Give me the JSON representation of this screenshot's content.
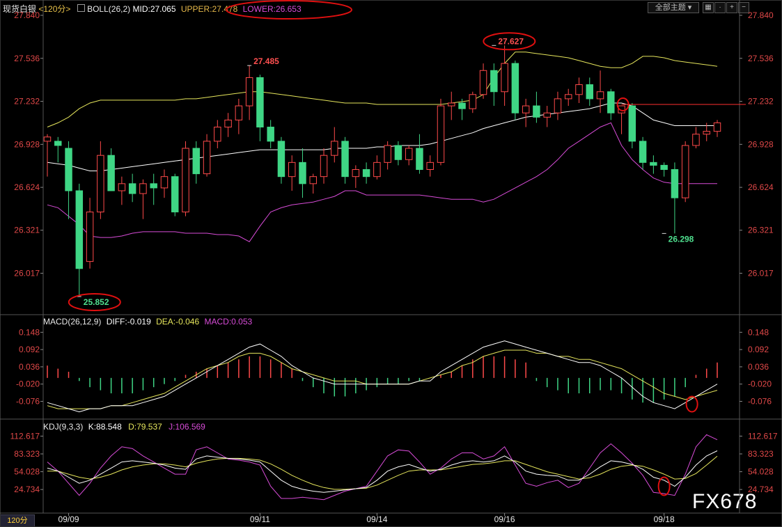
{
  "header": {
    "title": "现货白银",
    "period": "<120分>",
    "boll": "BOLL(26,2)",
    "mid": "MID:27.065",
    "upper": "UPPER:27.478",
    "lower": "LOWER:26.653",
    "theme_button": "全部主题",
    "icons": [
      "grid-icon",
      "dot-icon",
      "add-icon",
      "remove-icon"
    ]
  },
  "macd_header": {
    "label": "MACD(26,12,9)",
    "diff": "DIFF:-0.019",
    "dea": "DEA:-0.046",
    "macd": "MACD:0.053"
  },
  "kdj_header": {
    "label": "KDJ(9,3,3)",
    "k": "K:88.548",
    "d": "D:79.537",
    "j": "J:106.569"
  },
  "period_badge": "120分",
  "watermark": "FX678",
  "colors": {
    "up": "#ff4a4a",
    "down": "#3fd685",
    "mid": "#ffffff",
    "upper": "#e6e65c",
    "lower": "#d84cd8",
    "axis_label": "#e04848",
    "circle": "#e01010"
  },
  "chart_data": [
    {
      "type": "candlestick",
      "name": "price",
      "y_ticks": [
        27.84,
        27.536,
        27.232,
        26.928,
        26.624,
        26.321,
        26.017
      ],
      "ylim": [
        25.852,
        27.84
      ],
      "x_labels": [
        "09/09",
        "09/11",
        "09/14",
        "09/16",
        "09/18"
      ],
      "x_label_positions": [
        2,
        20,
        31,
        43,
        58
      ],
      "annotations": [
        {
          "text": "27.485",
          "index": 19,
          "value": 27.485,
          "kind": "high"
        },
        {
          "text": "27.627",
          "index": 42,
          "value": 27.627,
          "kind": "high",
          "circled": true
        },
        {
          "text": "25.852",
          "index": 3,
          "value": 25.852,
          "kind": "low",
          "circled": true
        },
        {
          "text": "26.298",
          "index": 58,
          "value": 26.298,
          "kind": "low"
        }
      ],
      "resistance_line": {
        "value": 27.21,
        "from_index": 54
      },
      "candles": [
        [
          26.95,
          27.0,
          26.7,
          26.98
        ],
        [
          26.95,
          26.98,
          26.8,
          26.92
        ],
        [
          26.9,
          26.95,
          26.4,
          26.6
        ],
        [
          26.6,
          26.65,
          25.852,
          26.05
        ],
        [
          26.1,
          26.55,
          26.05,
          26.45
        ],
        [
          26.45,
          26.95,
          26.4,
          26.85
        ],
        [
          26.85,
          26.9,
          26.6,
          26.6
        ],
        [
          26.6,
          26.7,
          26.5,
          26.65
        ],
        [
          26.65,
          26.72,
          26.52,
          26.58
        ],
        [
          26.58,
          26.68,
          26.4,
          26.65
        ],
        [
          26.65,
          26.72,
          26.5,
          26.62
        ],
        [
          26.62,
          26.75,
          26.55,
          26.7
        ],
        [
          26.7,
          26.72,
          26.42,
          26.45
        ],
        [
          26.45,
          26.95,
          26.42,
          26.9
        ],
        [
          26.9,
          26.95,
          26.65,
          26.72
        ],
        [
          26.72,
          27.0,
          26.7,
          26.95
        ],
        [
          26.95,
          27.1,
          26.9,
          27.05
        ],
        [
          27.05,
          27.15,
          26.98,
          27.1
        ],
        [
          27.1,
          27.25,
          27.0,
          27.2
        ],
        [
          27.2,
          27.485,
          27.1,
          27.4
        ],
        [
          27.4,
          27.42,
          26.95,
          27.05
        ],
        [
          27.05,
          27.1,
          26.9,
          26.95
        ],
        [
          26.95,
          26.98,
          26.65,
          26.7
        ],
        [
          26.7,
          26.85,
          26.6,
          26.8
        ],
        [
          26.8,
          26.9,
          26.55,
          26.65
        ],
        [
          26.65,
          26.72,
          26.58,
          26.7
        ],
        [
          26.7,
          26.9,
          26.65,
          26.85
        ],
        [
          26.85,
          27.05,
          26.8,
          26.95
        ],
        [
          26.95,
          26.98,
          26.65,
          26.7
        ],
        [
          26.7,
          26.78,
          26.62,
          26.75
        ],
        [
          26.75,
          26.8,
          26.65,
          26.7
        ],
        [
          26.7,
          26.85,
          26.68,
          26.8
        ],
        [
          26.8,
          26.95,
          26.75,
          26.92
        ],
        [
          26.92,
          26.95,
          26.78,
          26.82
        ],
        [
          26.82,
          26.92,
          26.78,
          26.9
        ],
        [
          26.9,
          27.0,
          26.72,
          26.75
        ],
        [
          26.75,
          26.85,
          26.7,
          26.8
        ],
        [
          26.8,
          27.25,
          26.78,
          27.2
        ],
        [
          27.2,
          27.3,
          27.1,
          27.22
        ],
        [
          27.22,
          27.25,
          27.1,
          27.18
        ],
        [
          27.18,
          27.3,
          27.15,
          27.28
        ],
        [
          27.28,
          27.5,
          27.25,
          27.45
        ],
        [
          27.45,
          27.5,
          27.2,
          27.3
        ],
        [
          27.3,
          27.627,
          27.2,
          27.5
        ],
        [
          27.5,
          27.52,
          27.1,
          27.15
        ],
        [
          27.15,
          27.25,
          27.05,
          27.2
        ],
        [
          27.2,
          27.3,
          27.08,
          27.12
        ],
        [
          27.12,
          27.2,
          27.05,
          27.15
        ],
        [
          27.15,
          27.3,
          27.1,
          27.25
        ],
        [
          27.25,
          27.32,
          27.2,
          27.28
        ],
        [
          27.28,
          27.4,
          27.22,
          27.35
        ],
        [
          27.35,
          27.4,
          27.2,
          27.25
        ],
        [
          27.25,
          27.45,
          27.15,
          27.3
        ],
        [
          27.3,
          27.32,
          27.1,
          27.15
        ],
        [
          27.15,
          27.2,
          27.0,
          27.2
        ],
        [
          27.2,
          27.22,
          26.9,
          26.95
        ],
        [
          26.95,
          26.98,
          26.75,
          26.8
        ],
        [
          26.8,
          26.85,
          26.72,
          26.78
        ],
        [
          26.78,
          26.8,
          26.7,
          26.75
        ],
        [
          26.75,
          26.8,
          26.298,
          26.55
        ],
        [
          26.55,
          26.95,
          26.52,
          26.92
        ],
        [
          26.92,
          27.05,
          26.9,
          27.0
        ],
        [
          27.0,
          27.08,
          26.95,
          27.02
        ],
        [
          27.02,
          27.1,
          26.98,
          27.08
        ]
      ],
      "upper_band": [
        27.05,
        27.08,
        27.12,
        27.18,
        27.22,
        27.24,
        27.24,
        27.24,
        27.24,
        27.24,
        27.24,
        27.24,
        27.24,
        27.25,
        27.25,
        27.26,
        27.27,
        27.28,
        27.29,
        27.3,
        27.3,
        27.29,
        27.28,
        27.27,
        27.26,
        27.25,
        27.24,
        27.23,
        27.22,
        27.22,
        27.22,
        27.21,
        27.21,
        27.21,
        27.21,
        27.21,
        27.21,
        27.21,
        27.22,
        27.23,
        27.24,
        27.28,
        27.4,
        27.5,
        27.58,
        27.58,
        27.57,
        27.56,
        27.55,
        27.54,
        27.52,
        27.5,
        27.48,
        27.47,
        27.47,
        27.5,
        27.55,
        27.55,
        27.54,
        27.52,
        27.51,
        27.5,
        27.49,
        27.48
      ],
      "mid_band": [
        26.8,
        26.79,
        26.78,
        26.76,
        26.74,
        26.74,
        26.75,
        26.76,
        26.77,
        26.78,
        26.79,
        26.8,
        26.81,
        26.82,
        26.83,
        26.84,
        26.85,
        26.86,
        26.87,
        26.88,
        26.89,
        26.89,
        26.89,
        26.89,
        26.89,
        26.89,
        26.89,
        26.9,
        26.9,
        26.9,
        26.9,
        26.91,
        26.91,
        26.92,
        26.92,
        26.92,
        26.93,
        26.95,
        26.97,
        26.99,
        27.01,
        27.04,
        27.06,
        27.08,
        27.1,
        27.12,
        27.13,
        27.14,
        27.15,
        27.16,
        27.17,
        27.18,
        27.2,
        27.22,
        27.22,
        27.2,
        27.15,
        27.1,
        27.08,
        27.06,
        27.06,
        27.06,
        27.06,
        27.06
      ],
      "lower_band": [
        26.5,
        26.48,
        26.42,
        26.36,
        26.28,
        26.27,
        26.27,
        26.28,
        26.3,
        26.31,
        26.31,
        26.31,
        26.31,
        26.3,
        26.3,
        26.3,
        26.29,
        26.29,
        26.28,
        26.24,
        26.35,
        26.45,
        26.48,
        26.5,
        26.51,
        26.52,
        26.54,
        26.56,
        26.6,
        26.6,
        26.57,
        26.57,
        26.57,
        26.57,
        26.57,
        26.57,
        26.56,
        26.55,
        26.54,
        26.54,
        26.54,
        26.52,
        26.54,
        26.58,
        26.62,
        26.66,
        26.7,
        26.75,
        26.82,
        26.9,
        26.95,
        27.0,
        27.05,
        27.08,
        26.92,
        26.82,
        26.75,
        26.69,
        26.66,
        26.65,
        26.65,
        26.65,
        26.65,
        26.65
      ]
    },
    {
      "type": "histogram+line",
      "name": "MACD",
      "y_ticks": [
        0.148,
        0.092,
        0.036,
        -0.02,
        -0.076
      ],
      "ylim": [
        -0.12,
        0.16
      ],
      "histogram": [
        0.04,
        0.03,
        0.02,
        -0.01,
        -0.03,
        -0.04,
        -0.05,
        -0.05,
        -0.05,
        -0.04,
        -0.03,
        -0.02,
        -0.01,
        0.01,
        0.02,
        0.03,
        0.04,
        0.05,
        0.06,
        0.07,
        0.07,
        0.06,
        0.05,
        0.03,
        -0.01,
        -0.03,
        -0.05,
        -0.06,
        -0.06,
        -0.05,
        -0.04,
        -0.03,
        -0.02,
        -0.02,
        -0.01,
        -0.01,
        0.0,
        0.01,
        0.02,
        0.04,
        0.06,
        0.07,
        0.07,
        0.07,
        0.06,
        0.05,
        -0.01,
        -0.03,
        -0.04,
        -0.05,
        -0.05,
        -0.05,
        -0.04,
        -0.04,
        -0.05,
        -0.07,
        -0.08,
        -0.08,
        -0.07,
        -0.06,
        -0.03,
        0.01,
        0.03,
        0.05
      ],
      "diff": [
        -0.08,
        -0.09,
        -0.1,
        -0.11,
        -0.1,
        -0.1,
        -0.09,
        -0.09,
        -0.09,
        -0.08,
        -0.07,
        -0.06,
        -0.04,
        -0.02,
        0.0,
        0.02,
        0.04,
        0.06,
        0.08,
        0.1,
        0.11,
        0.09,
        0.07,
        0.04,
        0.02,
        0.0,
        -0.01,
        -0.02,
        -0.02,
        -0.02,
        -0.02,
        -0.02,
        -0.02,
        -0.02,
        -0.02,
        -0.01,
        -0.01,
        0.02,
        0.04,
        0.06,
        0.08,
        0.1,
        0.11,
        0.12,
        0.11,
        0.1,
        0.09,
        0.08,
        0.07,
        0.06,
        0.05,
        0.05,
        0.04,
        0.02,
        0.0,
        -0.03,
        -0.06,
        -0.08,
        -0.09,
        -0.1,
        -0.08,
        -0.06,
        -0.04,
        -0.02
      ],
      "dea": [
        -0.09,
        -0.1,
        -0.1,
        -0.1,
        -0.1,
        -0.1,
        -0.09,
        -0.09,
        -0.08,
        -0.07,
        -0.06,
        -0.05,
        -0.03,
        -0.01,
        0.01,
        0.03,
        0.04,
        0.05,
        0.07,
        0.08,
        0.08,
        0.07,
        0.05,
        0.03,
        0.02,
        0.01,
        0.0,
        -0.01,
        -0.01,
        -0.01,
        -0.02,
        -0.02,
        -0.02,
        -0.02,
        -0.02,
        -0.01,
        0.0,
        0.01,
        0.02,
        0.04,
        0.05,
        0.07,
        0.08,
        0.09,
        0.09,
        0.09,
        0.08,
        0.08,
        0.07,
        0.07,
        0.06,
        0.06,
        0.05,
        0.04,
        0.03,
        0.01,
        -0.01,
        -0.03,
        -0.05,
        -0.06,
        -0.07,
        -0.06,
        -0.05,
        -0.04
      ]
    },
    {
      "type": "line",
      "name": "KDJ",
      "y_ticks": [
        112.617,
        83.323,
        54.028,
        24.734
      ],
      "ylim": [
        10,
        120
      ],
      "k": [
        60,
        55,
        45,
        35,
        40,
        50,
        60,
        70,
        72,
        70,
        68,
        65,
        60,
        58,
        75,
        80,
        78,
        76,
        75,
        73,
        70,
        55,
        40,
        30,
        25,
        22,
        20,
        22,
        24,
        26,
        28,
        40,
        55,
        62,
        66,
        60,
        55,
        58,
        65,
        70,
        72,
        70,
        72,
        80,
        70,
        55,
        50,
        48,
        47,
        40,
        40,
        50,
        62,
        72,
        70,
        66,
        58,
        45,
        40,
        30,
        45,
        65,
        80,
        88.5
      ],
      "d": [
        55,
        55,
        50,
        45,
        42,
        45,
        50,
        57,
        62,
        65,
        67,
        67,
        65,
        62,
        68,
        72,
        75,
        76,
        76,
        75,
        73,
        67,
        58,
        48,
        40,
        33,
        28,
        25,
        25,
        26,
        27,
        32,
        40,
        48,
        55,
        57,
        57,
        57,
        60,
        63,
        66,
        67,
        69,
        72,
        72,
        66,
        60,
        54,
        50,
        46,
        42,
        44,
        50,
        58,
        63,
        65,
        63,
        57,
        50,
        42,
        43,
        51,
        65,
        79.5
      ],
      "j": [
        70,
        55,
        35,
        15,
        35,
        60,
        80,
        95,
        92,
        80,
        70,
        60,
        50,
        50,
        90,
        95,
        85,
        75,
        73,
        70,
        65,
        30,
        10,
        10,
        12,
        10,
        8,
        15,
        22,
        26,
        30,
        55,
        80,
        90,
        88,
        70,
        50,
        60,
        75,
        85,
        85,
        75,
        80,
        95,
        65,
        35,
        30,
        36,
        40,
        28,
        35,
        60,
        85,
        100,
        85,
        68,
        48,
        20,
        18,
        15,
        50,
        95,
        115,
        106.6
      ]
    }
  ]
}
